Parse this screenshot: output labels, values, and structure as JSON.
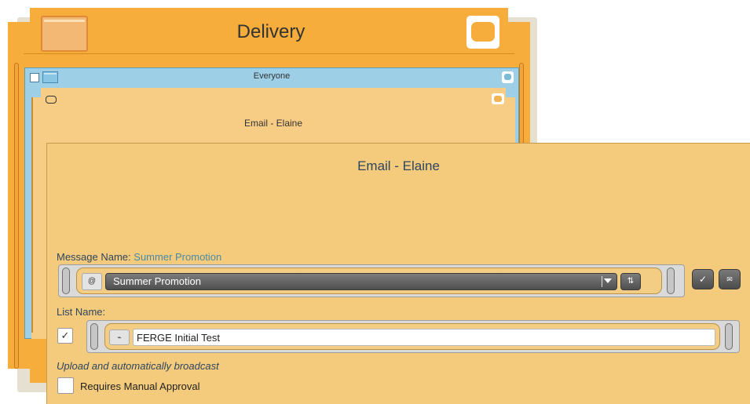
{
  "delivery": {
    "title": "Delivery"
  },
  "everyone": {
    "title": "Everyone"
  },
  "email_card": {
    "title": "Email - Elaine"
  },
  "email_panel": {
    "title": "Email - Elaine",
    "message_name_label": "Message Name:",
    "message_name_value": "Summer Promotion",
    "message_select": {
      "selected": "Summer Promotion",
      "prefix_icon": "@"
    },
    "refresh_icon": "⇅",
    "confirm_icon": "✓",
    "mail_icon": "✉",
    "list_name_label": "List Name:",
    "list_checked": true,
    "list_check_glyph": "✓",
    "list_icon": "⌁",
    "list_name_value": "FERGE Initial Test",
    "upload_text": "Upload and automatically broadcast",
    "requires_approval_label": "Requires Manual Approval",
    "requires_approval_checked": false
  },
  "colors": {
    "delivery_bg": "#f6ad3b",
    "everyone_bg": "#9dcfe6",
    "email_bg": "#f4cb7c",
    "title_text": "#2e4560",
    "link_value": "#4a8aa5"
  }
}
